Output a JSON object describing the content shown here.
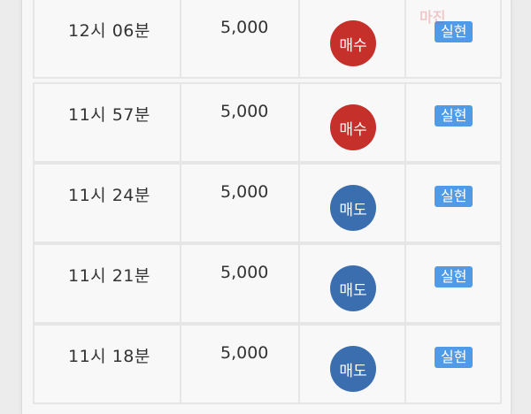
{
  "watermark": "마진",
  "rows": [
    {
      "time": "12시 06분",
      "amount": "5,000",
      "action": "매수",
      "status": "실현",
      "action_type": "buy"
    },
    {
      "time": "11시 57분",
      "amount": "5,000",
      "action": "매수",
      "status": "실현",
      "action_type": "buy"
    },
    {
      "time": "11시 24분",
      "amount": "5,000",
      "action": "매도",
      "status": "실현",
      "action_type": "sell"
    },
    {
      "time": "11시 21분",
      "amount": "5,000",
      "action": "매도",
      "status": "실현",
      "action_type": "sell"
    },
    {
      "time": "11시 18분",
      "amount": "5,000",
      "action": "매도",
      "status": "실현",
      "action_type": "sell"
    }
  ],
  "colors": {
    "buy": "#c5302a",
    "sell": "#3b6eaf",
    "badge": "#4f9be8"
  }
}
